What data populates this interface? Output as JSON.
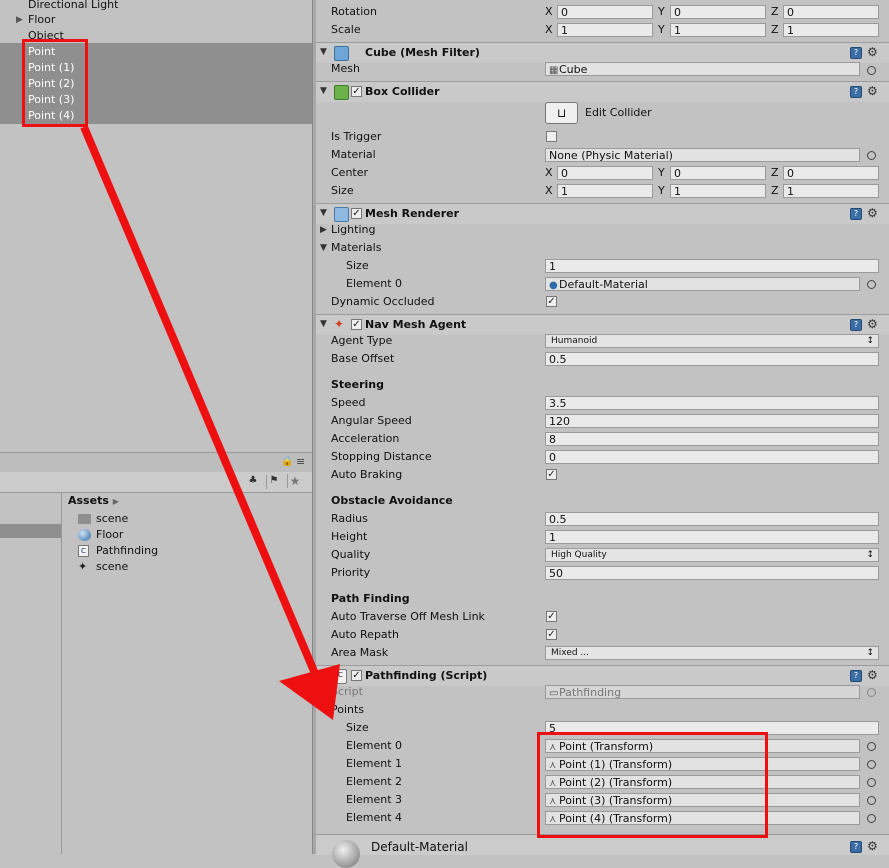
{
  "hierarchy": {
    "items": [
      {
        "label": "Directional Light",
        "selected": false,
        "expandable": false
      },
      {
        "label": "Floor",
        "selected": false,
        "expandable": true
      },
      {
        "label": "Object",
        "selected": false,
        "expandable": false
      },
      {
        "label": "Point",
        "selected": true,
        "expandable": false
      },
      {
        "label": "Point (1)",
        "selected": true,
        "expandable": false
      },
      {
        "label": "Point (2)",
        "selected": true,
        "expandable": false
      },
      {
        "label": "Point (3)",
        "selected": true,
        "expandable": false
      },
      {
        "label": "Point (4)",
        "selected": true,
        "expandable": false
      }
    ]
  },
  "project": {
    "breadcrumb": "Assets",
    "assets": [
      {
        "label": "scene",
        "icon": "folder-icon"
      },
      {
        "label": "Floor",
        "icon": "material-sphere-icon"
      },
      {
        "label": "Pathfinding",
        "icon": "csharp-script-icon"
      },
      {
        "label": "scene",
        "icon": "unity-scene-icon"
      }
    ]
  },
  "inspector": {
    "transform": {
      "rotation_label": "Rotation",
      "rotation": {
        "x": "0",
        "y": "0",
        "z": "0"
      },
      "scale_label": "Scale",
      "scale": {
        "x": "1",
        "y": "1",
        "z": "1"
      }
    },
    "mesh_filter": {
      "title": "Cube (Mesh Filter)",
      "mesh_label": "Mesh",
      "mesh_value": "Cube"
    },
    "box_collider": {
      "title": "Box Collider",
      "edit_label": "Edit Collider",
      "is_trigger_label": "Is Trigger",
      "is_trigger": false,
      "material_label": "Material",
      "material_value": "None (Physic Material)",
      "center_label": "Center",
      "center": {
        "x": "0",
        "y": "0",
        "z": "0"
      },
      "size_label": "Size",
      "size": {
        "x": "1",
        "y": "1",
        "z": "1"
      }
    },
    "mesh_renderer": {
      "title": "Mesh Renderer",
      "lighting_label": "Lighting",
      "materials_label": "Materials",
      "size_label": "Size",
      "size_value": "1",
      "element0_label": "Element 0",
      "element0_value": "Default-Material",
      "dynamic_occluded_label": "Dynamic Occluded",
      "dynamic_occluded": true
    },
    "nav_mesh_agent": {
      "title": "Nav Mesh Agent",
      "agent_type_label": "Agent Type",
      "agent_type": "Humanoid",
      "base_offset_label": "Base Offset",
      "base_offset": "0.5",
      "steering_header": "Steering",
      "speed_label": "Speed",
      "speed": "3.5",
      "angular_speed_label": "Angular Speed",
      "angular_speed": "120",
      "acceleration_label": "Acceleration",
      "acceleration": "8",
      "stopping_distance_label": "Stopping Distance",
      "stopping_distance": "0",
      "auto_braking_label": "Auto Braking",
      "auto_braking": true,
      "obstacle_header": "Obstacle Avoidance",
      "radius_label": "Radius",
      "radius": "0.5",
      "height_label": "Height",
      "height": "1",
      "quality_label": "Quality",
      "quality": "High Quality",
      "priority_label": "Priority",
      "priority": "50",
      "path_header": "Path Finding",
      "auto_traverse_label": "Auto Traverse Off Mesh Link",
      "auto_traverse": true,
      "auto_repath_label": "Auto Repath",
      "auto_repath": true,
      "area_mask_label": "Area Mask",
      "area_mask": "Mixed ..."
    },
    "pathfinding": {
      "title": "Pathfinding (Script)",
      "script_label": "Script",
      "script_value": "Pathfinding",
      "points_label": "Points",
      "size_label": "Size",
      "size_value": "5",
      "elements": [
        {
          "label": "Element 0",
          "value": "Point (Transform)"
        },
        {
          "label": "Element 1",
          "value": "Point (1) (Transform)"
        },
        {
          "label": "Element 2",
          "value": "Point (2) (Transform)"
        },
        {
          "label": "Element 3",
          "value": "Point (3) (Transform)"
        },
        {
          "label": "Element 4",
          "value": "Point (4) (Transform)"
        }
      ]
    },
    "material_footer": {
      "title": "Default-Material"
    }
  },
  "colors": {
    "annotation": "#ee1010",
    "selection": "#8f8f8f"
  }
}
